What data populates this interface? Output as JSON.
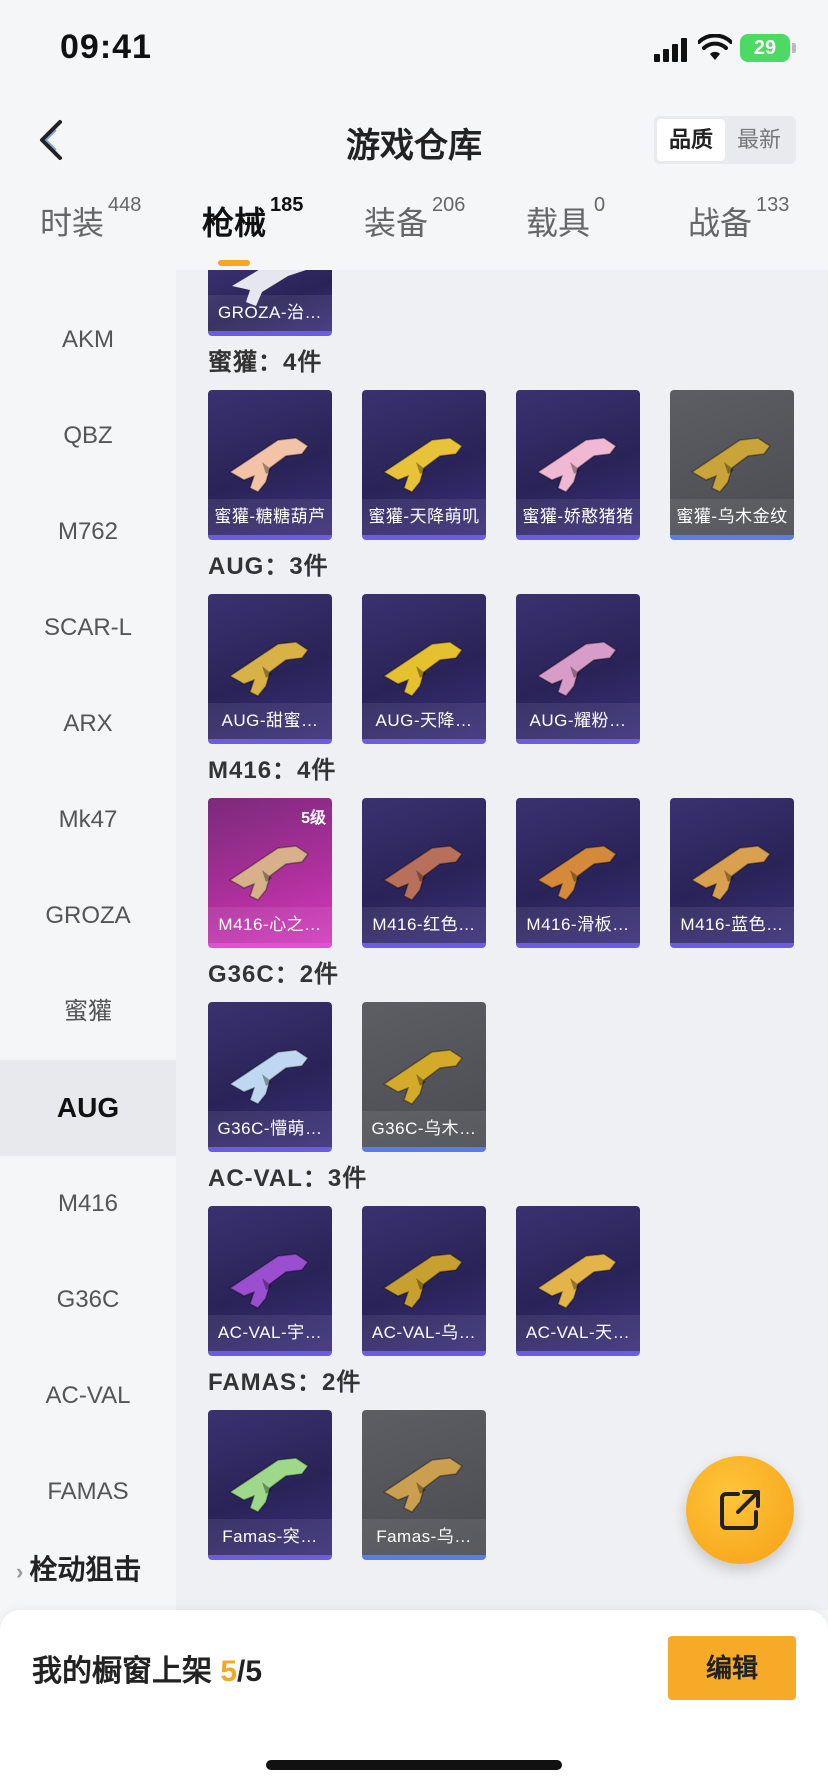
{
  "status_bar": {
    "time": "09:41",
    "battery": "29"
  },
  "header": {
    "title": "游戏仓库",
    "sort_options": [
      "品质",
      "最新"
    ]
  },
  "tabs": [
    {
      "label": "时装",
      "count": "448"
    },
    {
      "label": "枪械",
      "count": "185"
    },
    {
      "label": "装备",
      "count": "206"
    },
    {
      "label": "载具",
      "count": "0"
    },
    {
      "label": "战备",
      "count": "133"
    }
  ],
  "sidebar": {
    "items": [
      "AKM",
      "QBZ",
      "M762",
      "SCAR-L",
      "ARX",
      "Mk47",
      "GROZA",
      "蜜獾",
      "AUG",
      "M416",
      "G36C",
      "AC-VAL",
      "FAMAS"
    ],
    "active": "AUG",
    "group": "栓动狙击"
  },
  "content": {
    "top_card": {
      "name": "GROZA-治…"
    },
    "sections": [
      {
        "title": "蜜獾：4件",
        "items": [
          {
            "name": "蜜獾-糖糖葫芦",
            "style": "purple"
          },
          {
            "name": "蜜獾-天降萌叽",
            "style": "purple"
          },
          {
            "name": "蜜獾-娇憨猪猪",
            "style": "purple"
          },
          {
            "name": "蜜獾-乌木金纹",
            "style": "gray"
          }
        ]
      },
      {
        "title": "AUG：3件",
        "items": [
          {
            "name": "AUG-甜蜜…",
            "style": "purple"
          },
          {
            "name": "AUG-天降…",
            "style": "purple"
          },
          {
            "name": "AUG-耀粉…",
            "style": "purple"
          }
        ]
      },
      {
        "title": "M416：4件",
        "items": [
          {
            "name": "M416-心之…",
            "style": "pink",
            "level": "5级"
          },
          {
            "name": "M416-红色…",
            "style": "purple"
          },
          {
            "name": "M416-滑板…",
            "style": "purple"
          },
          {
            "name": "M416-蓝色…",
            "style": "purple"
          }
        ]
      },
      {
        "title": "G36C：2件",
        "items": [
          {
            "name": "G36C-懵萌…",
            "style": "purple"
          },
          {
            "name": "G36C-乌木…",
            "style": "gray"
          }
        ]
      },
      {
        "title": "AC-VAL：3件",
        "items": [
          {
            "name": "AC-VAL-宇…",
            "style": "purple"
          },
          {
            "name": "AC-VAL-乌…",
            "style": "purple"
          },
          {
            "name": "AC-VAL-天…",
            "style": "purple"
          }
        ]
      },
      {
        "title": "FAMAS：2件",
        "items": [
          {
            "name": "Famas-突…",
            "style": "purple"
          },
          {
            "name": "Famas-乌…",
            "style": "gray"
          }
        ]
      }
    ]
  },
  "bottom_bar": {
    "label": "我的橱窗上架",
    "current": "5",
    "total": "/5",
    "edit": "编辑"
  },
  "colors": {
    "accent": "#f5a623",
    "card_purple": "#2a2358",
    "card_gray": "#4b4c51",
    "card_pink": "#b0309e"
  }
}
